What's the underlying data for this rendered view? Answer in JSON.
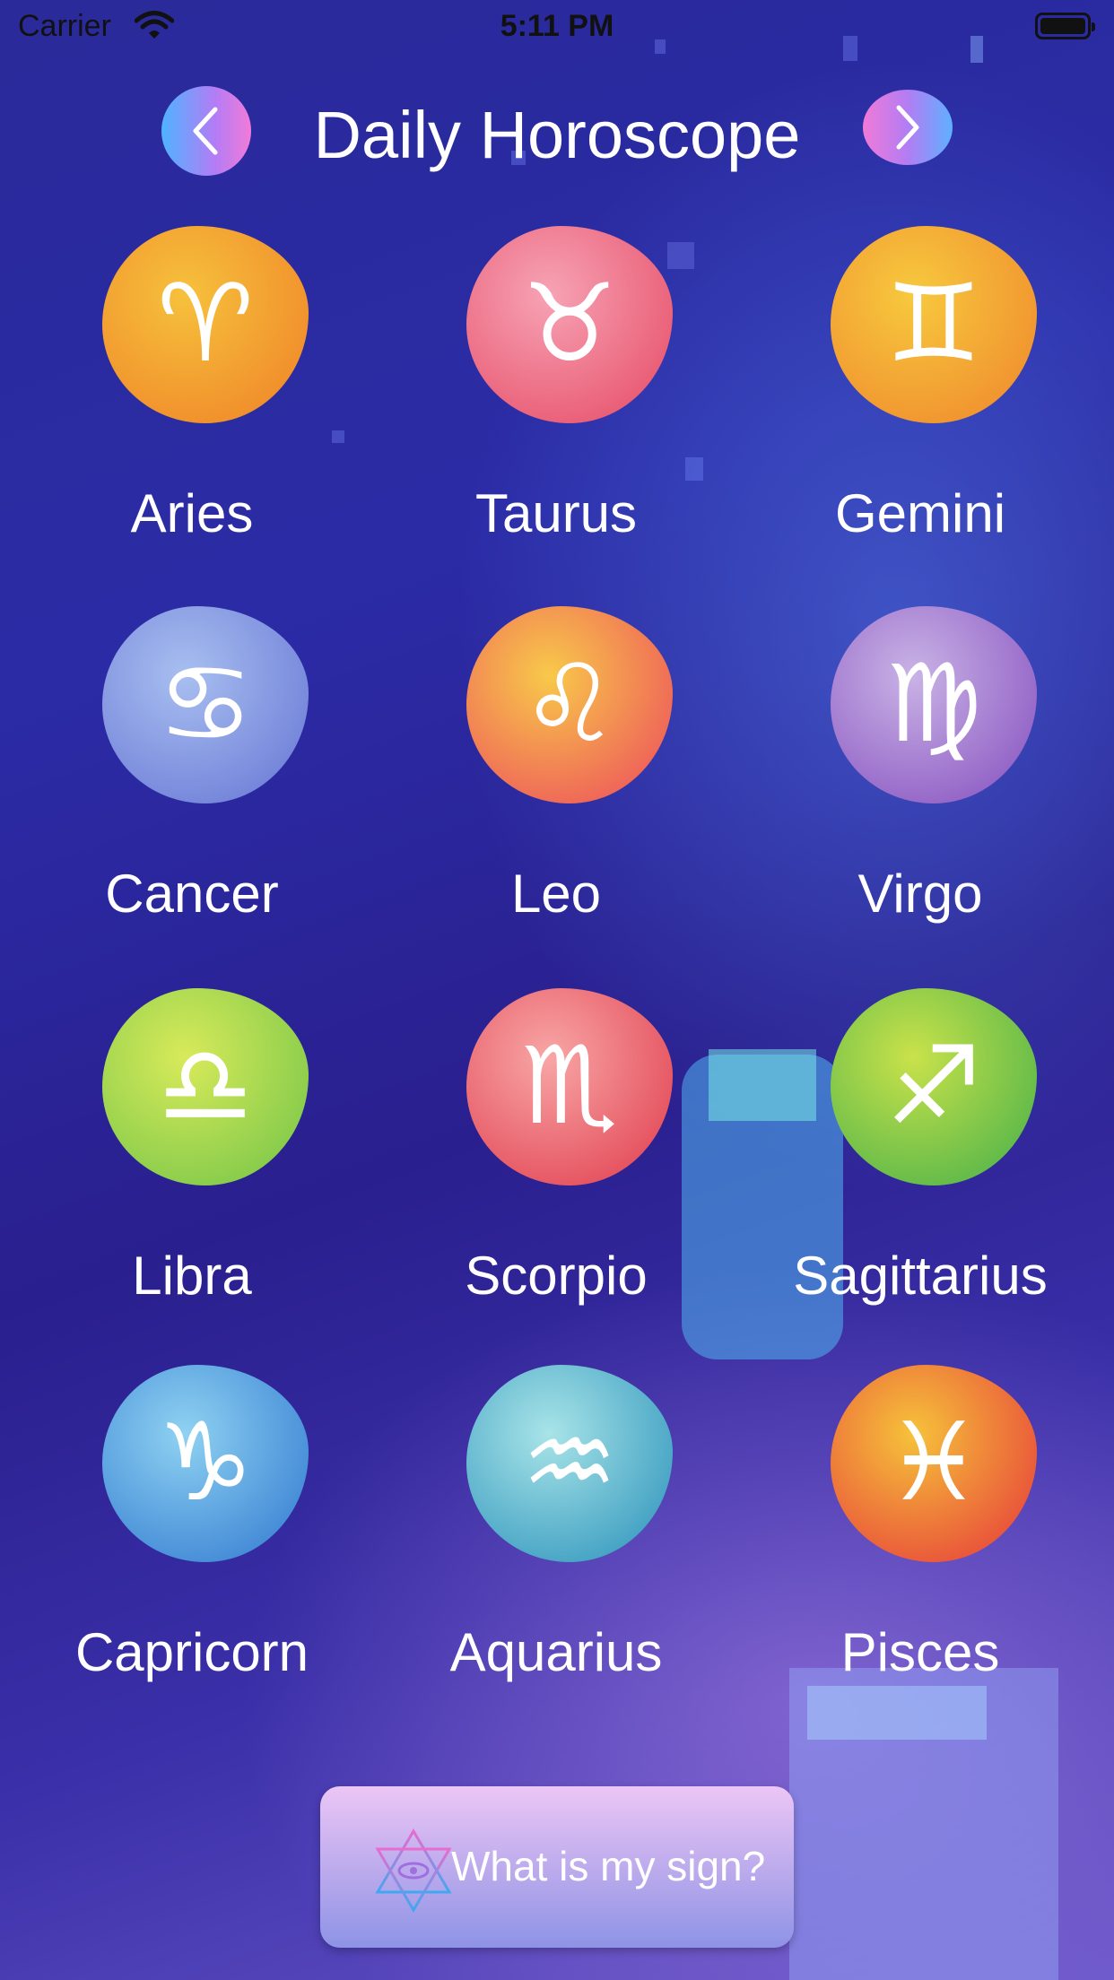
{
  "status_bar": {
    "carrier": "Carrier",
    "time": "5:11 PM"
  },
  "header": {
    "title": "Daily Horoscope",
    "prev_icon": "chevron-left-icon",
    "next_icon": "chevron-right-icon"
  },
  "signs": [
    {
      "name": "Aries",
      "icon": "aries-icon",
      "glyph": "♈",
      "color_a": "#f6c13c",
      "color_b": "#f08a2a"
    },
    {
      "name": "Taurus",
      "icon": "taurus-icon",
      "glyph": "♉",
      "color_a": "#f7a3b5",
      "color_b": "#e8566f"
    },
    {
      "name": "Gemini",
      "icon": "gemini-icon",
      "glyph": "♊",
      "color_a": "#f7c93e",
      "color_b": "#f08f2e"
    },
    {
      "name": "Cancer",
      "icon": "cancer-icon",
      "glyph": "♋",
      "color_a": "#a8bff0",
      "color_b": "#6f7fd8"
    },
    {
      "name": "Leo",
      "icon": "leo-icon",
      "glyph": "♌",
      "color_a": "#f8c94a",
      "color_b": "#ee5a5a"
    },
    {
      "name": "Virgo",
      "icon": "virgo-icon",
      "glyph": "♍",
      "color_a": "#c9b3e6",
      "color_b": "#8e5cc4"
    },
    {
      "name": "Libra",
      "icon": "libra-icon",
      "glyph": "♎",
      "color_a": "#d8ea5a",
      "color_b": "#7fc94a"
    },
    {
      "name": "Scorpio",
      "icon": "scorpio-icon",
      "glyph": "♏",
      "color_a": "#f8a6a6",
      "color_b": "#e34a58"
    },
    {
      "name": "Sagittarius",
      "icon": "sagittarius-icon",
      "glyph": "♐",
      "color_a": "#c9e24a",
      "color_b": "#56b64a"
    },
    {
      "name": "Capricorn",
      "icon": "capricorn-icon",
      "glyph": "♑",
      "color_a": "#8fd2f2",
      "color_b": "#3c84d4"
    },
    {
      "name": "Aquarius",
      "icon": "aquarius-icon",
      "glyph": "♒",
      "color_a": "#a8e4e8",
      "color_b": "#3a9cc0"
    },
    {
      "name": "Pisces",
      "icon": "pisces-icon",
      "glyph": "♓",
      "color_a": "#f6c23a",
      "color_b": "#e8493a"
    }
  ],
  "bottom_button": {
    "label": "What is my sign?",
    "icon": "star-of-david-eye-icon"
  }
}
